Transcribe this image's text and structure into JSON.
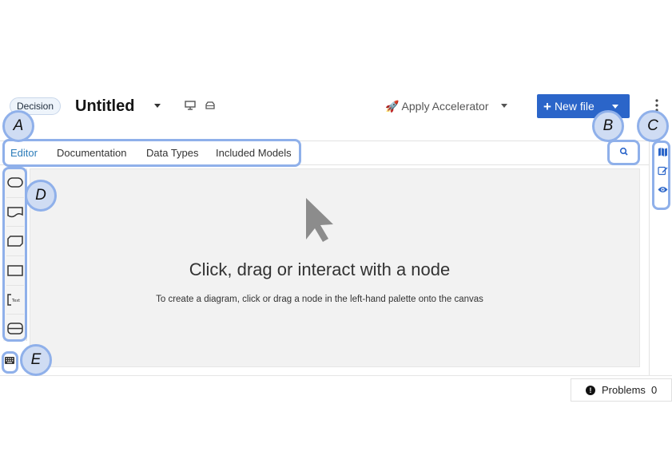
{
  "header": {
    "badge": "Decision",
    "title": "Untitled",
    "accelerator_label": "🚀 Apply Accelerator",
    "new_file_label": "New file"
  },
  "tabs": [
    {
      "label": "Editor",
      "active": true
    },
    {
      "label": "Documentation",
      "active": false
    },
    {
      "label": "Data Types",
      "active": false
    },
    {
      "label": "Included Models",
      "active": false
    }
  ],
  "palette": {
    "items": [
      "input-data-node-icon",
      "knowledge-source-node-icon",
      "business-knowledge-model-node-icon",
      "decision-node-icon",
      "text-annotation-node-icon",
      "decision-service-node-icon"
    ]
  },
  "right_sidebar": {
    "items": [
      "map-icon",
      "edit-icon",
      "eye-icon"
    ]
  },
  "canvas": {
    "empty_title": "Click, drag or interact with a node",
    "empty_subtitle": "To create a diagram, click or drag a node in the left-hand palette onto the canvas"
  },
  "status_bar": {
    "problems_label": "Problems",
    "problems_count": "0"
  },
  "annotations": {
    "A": "A",
    "B": "B",
    "C": "C",
    "D": "D",
    "E": "E"
  },
  "colors": {
    "primary": "#2b65c9",
    "active_tab": "#2b7bb9",
    "annotation_border": "#8fb0ea",
    "annotation_fill": "#cfdcf3"
  }
}
